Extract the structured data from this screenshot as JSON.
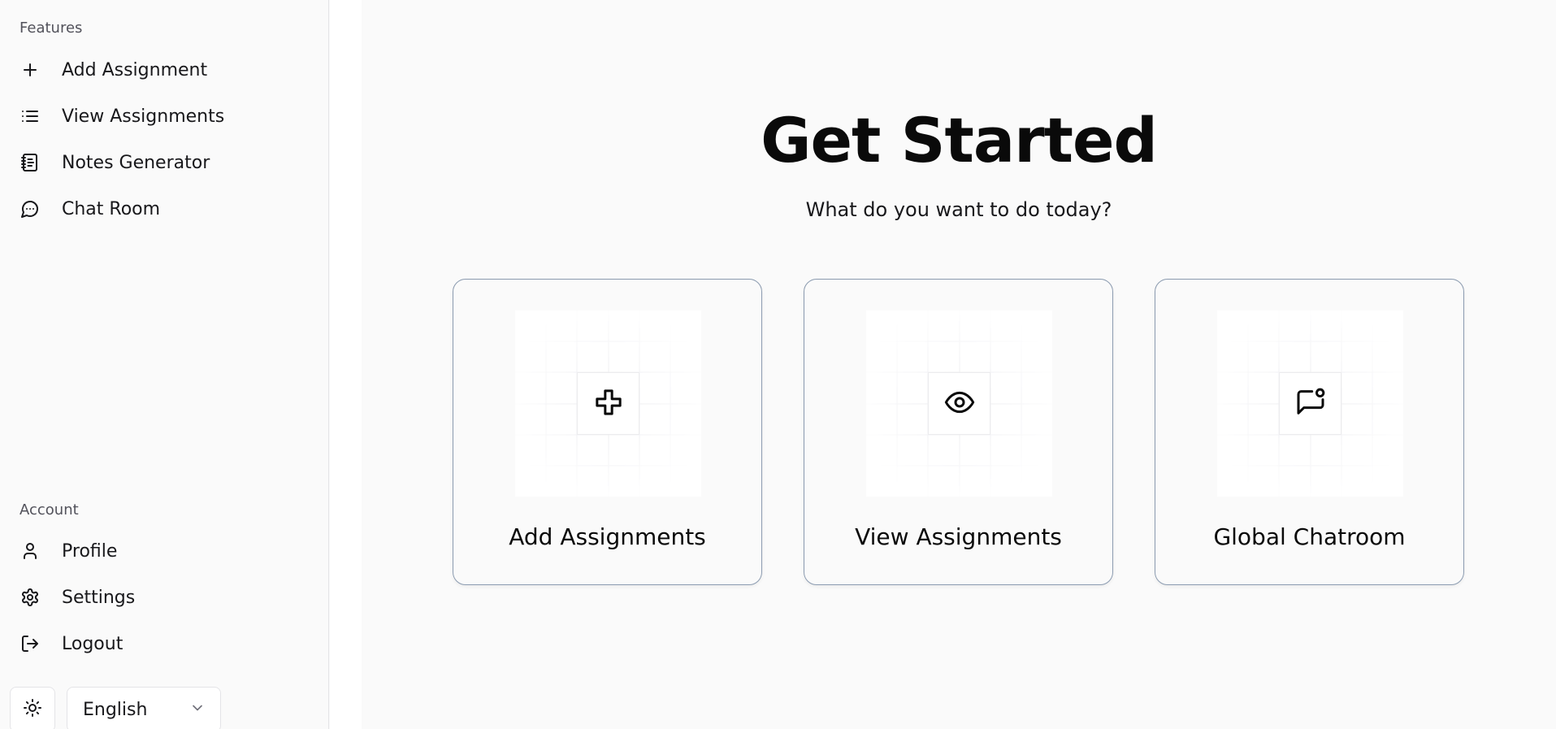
{
  "sidebar": {
    "features_label": "Features",
    "features": [
      {
        "label": "Add Assignment",
        "icon": "plus-icon"
      },
      {
        "label": "View Assignments",
        "icon": "list-icon"
      },
      {
        "label": "Notes Generator",
        "icon": "notebook-icon"
      },
      {
        "label": "Chat Room",
        "icon": "message-circle-icon"
      }
    ],
    "account_label": "Account",
    "account": [
      {
        "label": "Profile",
        "icon": "user-icon"
      },
      {
        "label": "Settings",
        "icon": "gear-icon"
      },
      {
        "label": "Logout",
        "icon": "logout-icon"
      }
    ],
    "theme_icon": "sun-icon",
    "language": {
      "selected": "English",
      "icon": "chevron-down-icon"
    }
  },
  "main": {
    "title": "Get Started",
    "subtitle": "What do you want to do today?",
    "cards": [
      {
        "title": "Add Assignments",
        "icon": "plus-outline-icon"
      },
      {
        "title": "View Assignments",
        "icon": "eye-icon"
      },
      {
        "title": "Global Chatroom",
        "icon": "message-notification-icon"
      }
    ]
  },
  "colors": {
    "background": "#fafafa",
    "sidebar_border": "#e4e4e7",
    "card_border": "#8b9bb0",
    "text": "#0a0a0a"
  }
}
